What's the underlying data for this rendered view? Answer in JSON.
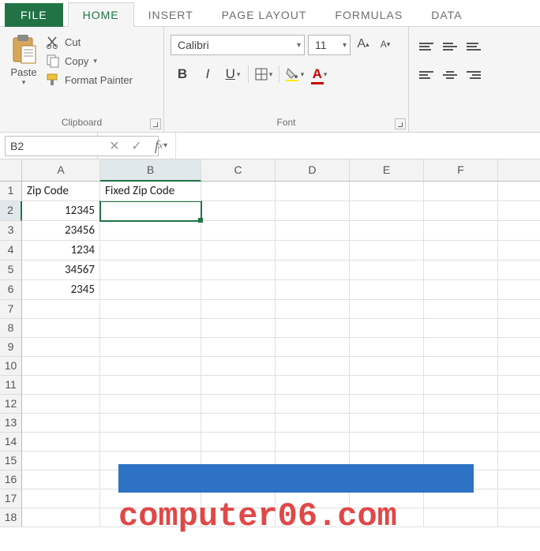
{
  "tabs": {
    "file": "FILE",
    "home": "HOME",
    "insert": "INSERT",
    "pagelayout": "PAGE LAYOUT",
    "formulas": "FORMULAS",
    "data": "DATA"
  },
  "ribbon": {
    "clipboard": {
      "paste": "Paste",
      "cut": "Cut",
      "copy": "Copy",
      "fmt": "Format Painter",
      "label": "Clipboard"
    },
    "font": {
      "family": "Calibri",
      "size": "11",
      "label": "Font"
    }
  },
  "namebox": "B2",
  "formula": "",
  "cols": [
    "A",
    "B",
    "C",
    "D",
    "E",
    "F"
  ],
  "rows": [
    "1",
    "2",
    "3",
    "4",
    "5",
    "6",
    "7",
    "8",
    "9",
    "10",
    "11",
    "12",
    "13",
    "14",
    "15",
    "16",
    "17",
    "18"
  ],
  "cells": {
    "A1": "Zip Code",
    "B1": "Fixed Zip Code",
    "A2": "12345",
    "A3": "23456",
    "A4": "1234",
    "A5": "34567",
    "A6": "2345"
  },
  "selected": "B2",
  "watermark": "computer06.com"
}
